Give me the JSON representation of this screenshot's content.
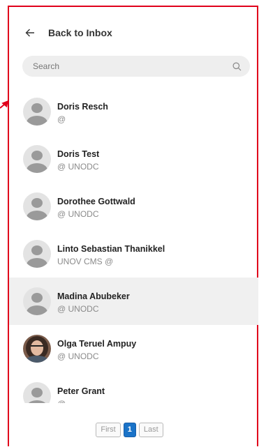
{
  "header": {
    "back_label": "Back to Inbox"
  },
  "search": {
    "placeholder": "Search"
  },
  "contacts": [
    {
      "name": "Doris Resch",
      "sub": "@"
    },
    {
      "name": "Doris Test",
      "sub": "@ UNODC"
    },
    {
      "name": "Dorothee Gottwald",
      "sub": "@ UNODC"
    },
    {
      "name": "Linto Sebastian Thanikkel",
      "sub": "UNOV CMS @"
    },
    {
      "name": "Madina Abubeker",
      "sub": "@ UNODC"
    },
    {
      "name": "Olga Teruel Ampuy",
      "sub": "@ UNODC"
    },
    {
      "name": "Peter Grant",
      "sub": "@"
    }
  ],
  "pagination": {
    "first": "First",
    "current": "1",
    "last": "Last"
  },
  "colors": {
    "annotation": "#e0001b",
    "active_page": "#1a73c8",
    "selected_row": "#f0f0f0"
  }
}
